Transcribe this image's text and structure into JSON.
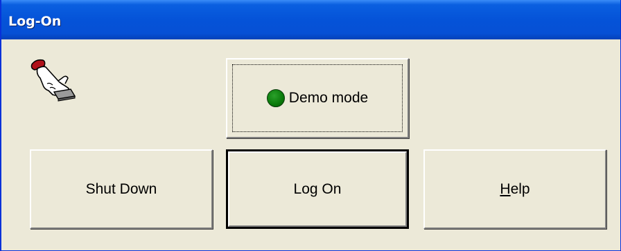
{
  "window": {
    "title": "Log-On"
  },
  "icons": {
    "hand": "pointing-hand-icon"
  },
  "buttons": {
    "demo_mode_label": "Demo mode",
    "demo_mode_indicator_color": "#0a7a0a",
    "shutdown_label": "Shut Down",
    "logon_label": "Log On",
    "help_label_accel": "H",
    "help_label_rest": "elp"
  },
  "colors": {
    "titlebar": "#0553d8",
    "window_bg": "#ece9d8"
  }
}
